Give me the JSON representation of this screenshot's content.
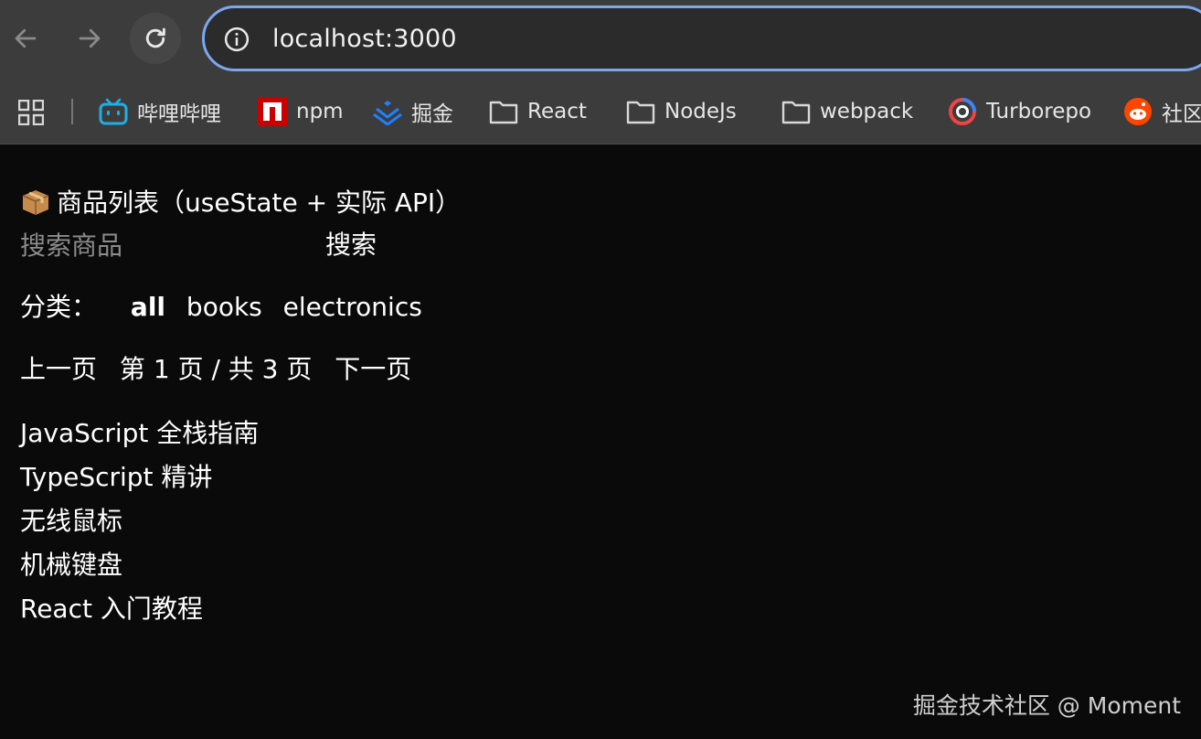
{
  "browser": {
    "url": "localhost:3000",
    "accent_color": "#7ba7ef",
    "bookmarks": [
      {
        "label": "哔哩哔哩",
        "icon": "bilibili-icon",
        "color": "#23ade5"
      },
      {
        "label": "npm",
        "icon": "npm-icon",
        "color": "#cb0000"
      },
      {
        "label": "掘金",
        "icon": "juejin-icon",
        "color": "#1e80ff"
      },
      {
        "label": "React",
        "icon": "folder-icon"
      },
      {
        "label": "NodeJs",
        "icon": "folder-icon"
      },
      {
        "label": "webpack",
        "icon": "folder-icon"
      },
      {
        "label": "Turborepo",
        "icon": "turborepo-icon"
      },
      {
        "label": "社区",
        "icon": "reddit-icon",
        "color": "#ff4500"
      }
    ]
  },
  "page": {
    "heading": "商品列表（useState + 实际 API）",
    "search": {
      "placeholder": "搜索商品",
      "button_label": "搜索"
    },
    "categories": {
      "label": "分类：",
      "options": [
        "all",
        "books",
        "electronics"
      ],
      "active": "all"
    },
    "pagination": {
      "prev_label": "上一页",
      "status": "第 1 页 / 共 3 页",
      "next_label": "下一页"
    },
    "products": [
      "JavaScript 全栈指南",
      "TypeScript 精讲",
      "无线鼠标",
      "机械键盘",
      "React 入门教程"
    ]
  },
  "watermark": "掘金技术社区 @ Moment"
}
